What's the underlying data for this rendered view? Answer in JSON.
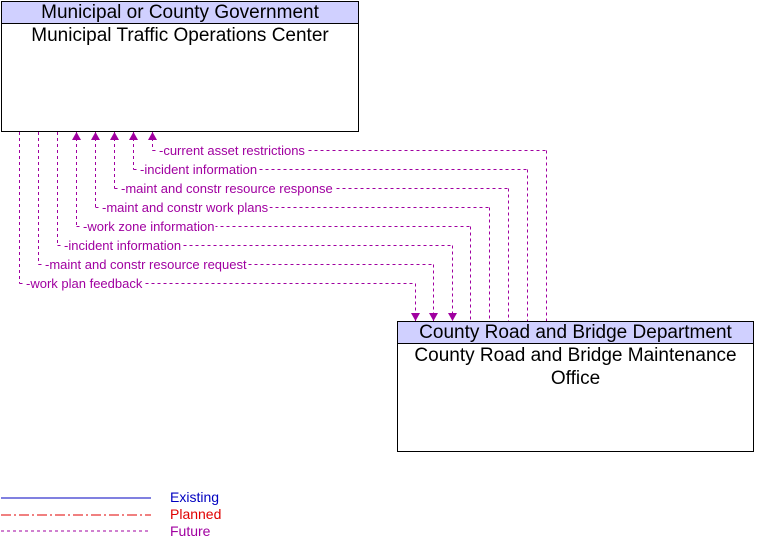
{
  "top_box": {
    "group": "Municipal or County Government",
    "title": "Municipal Traffic Operations Center"
  },
  "bottom_box": {
    "group": "County Road and Bridge Department",
    "title": "County Road and Bridge Maintenance Office"
  },
  "flows": [
    {
      "label": "current asset restrictions",
      "direction": "to-top",
      "status": "Future"
    },
    {
      "label": "incident information",
      "direction": "to-top",
      "status": "Future"
    },
    {
      "label": "maint and constr resource response",
      "direction": "to-top",
      "status": "Future"
    },
    {
      "label": "maint and constr work plans",
      "direction": "to-top",
      "status": "Future"
    },
    {
      "label": "work zone information",
      "direction": "to-top",
      "status": "Future"
    },
    {
      "label": "incident information",
      "direction": "to-bottom",
      "status": "Future"
    },
    {
      "label": "maint and constr resource request",
      "direction": "to-bottom",
      "status": "Future"
    },
    {
      "label": "work plan feedback",
      "direction": "to-bottom",
      "status": "Future"
    }
  ],
  "legend": {
    "items": [
      {
        "label": "Existing",
        "color": "#0000c0"
      },
      {
        "label": "Planned",
        "color": "#e00000"
      },
      {
        "label": "Future",
        "color": "#a000a0"
      }
    ]
  },
  "colors": {
    "flow": "#a000a0",
    "header_bg": "#d0d0ff"
  }
}
